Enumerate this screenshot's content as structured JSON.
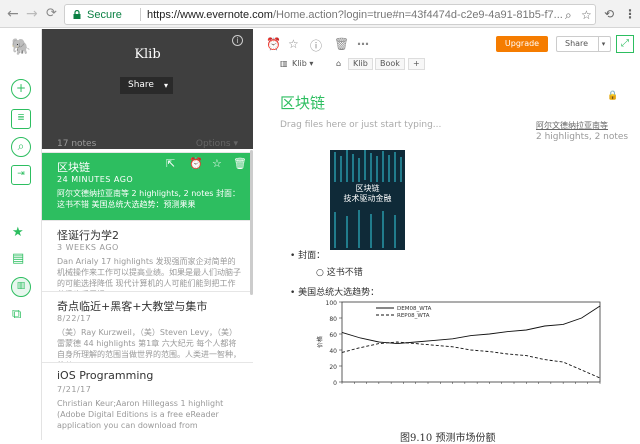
{
  "browser": {
    "secure_label": "Secure",
    "url_host": "https://www.evernote.com",
    "url_path": "/Home.action?login=true#n=43f4474d-c2e9-4a91-81b5-f7..."
  },
  "notebook": {
    "name": "Klib",
    "share_label": "Share"
  },
  "note_list": {
    "count_label": "17 notes",
    "options_label": "Options",
    "notes": [
      {
        "title": "区块链",
        "date": "24 MINUTES AGO",
        "snippet": "阿尔文德纳拉亚南等 2 highlights, 2 notes 封面： 这书不错 美国总统大选趋势：预测果果"
      },
      {
        "title": "怪诞行为学2",
        "date": "3 WEEKS AGO",
        "snippet": "Dan Arialy 17 highlights 发现强而家企对简单的机械操作来工作可以提高业绩。如果是最人们动脑子的可能选择降低 现代计算机的人可能们能到把工作分级也采用提"
      },
      {
        "title": "奇点临近+黑客+大教堂与集市",
        "date": "8/22/17",
        "snippet": "（美）Ray Kurzweil，（美）Steven Levy，（美）雷蒙德 44 highlights 第1章 六大纪元 每个人都将自身所理解的范围当做世界的范围。人类进一智种，将从"
      },
      {
        "title": "iOS Programming",
        "date": "7/21/17",
        "snippet": "Christian Keur;Aaron Hillegass 1 highlight (Adobe Digital Editions is a free eReader application you can download from"
      }
    ]
  },
  "editor": {
    "upgrade_label": "Upgrade",
    "share_label": "Share",
    "notebook_label": "Klib",
    "tags": [
      "Klib",
      "Book",
      "+"
    ],
    "note_title": "区块链",
    "drop_hint": "Drag files here or just start typing...",
    "author_link": "阿尔文德纳拉亚南等",
    "highlights": "2 highlights, 2 notes",
    "bullet_cover": "封面：",
    "bullet_cover_sub": "这书不错",
    "bullet_election": "美国总统大选趋势：",
    "book_cover_title": "区块链\n技术驱动金融",
    "figure_caption": "图9.10 预测市场份额"
  },
  "chart_data": {
    "type": "line",
    "series": [
      {
        "name": "DEM08_WTA",
        "values": [
          62,
          55,
          50,
          48,
          50,
          52,
          54,
          58,
          60,
          63,
          65,
          70,
          72,
          80,
          95
        ]
      },
      {
        "name": "REP08_WTA",
        "values": [
          37,
          43,
          48,
          50,
          48,
          46,
          44,
          40,
          38,
          35,
          33,
          28,
          25,
          15,
          5
        ]
      }
    ],
    "ylim": [
      0,
      100
    ],
    "yticks": [
      0,
      20,
      40,
      60,
      80,
      100
    ],
    "ylabel": "价格",
    "xlabel": "",
    "title": ""
  },
  "colors": {
    "accent": "#2dbe60",
    "upgrade": "#f57c00",
    "notebook_bg": "#3f3f3f"
  }
}
